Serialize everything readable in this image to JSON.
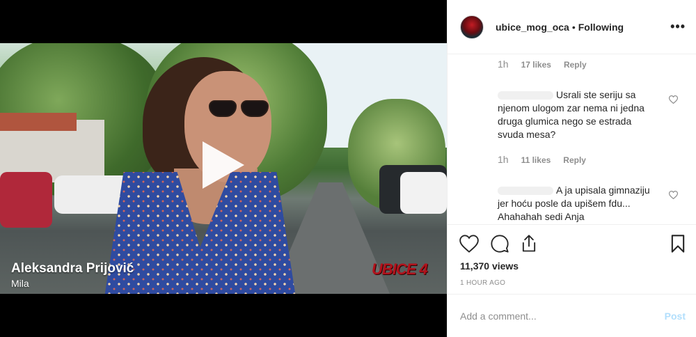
{
  "video": {
    "caption_name": "Aleksandra Prijović",
    "caption_role": "Mila",
    "watermark": "UBICE 4",
    "play_icon": "play-icon"
  },
  "header": {
    "avatar_label": "UBICE MOG OCA",
    "username": "ubice_mog_oca",
    "separator": "•",
    "follow_status": "Following",
    "more_icon": "more-horizontal-icon"
  },
  "comments": [
    {
      "time": "1h",
      "likes": "17 likes",
      "reply": "Reply"
    },
    {
      "text": "Usrali ste seriju sa njenom ulogom zar nema ni jedna druga glumica nego se estrada svuda mesa?",
      "time": "1h",
      "likes": "11 likes",
      "reply": "Reply"
    },
    {
      "text": "A ja upisala gimnaziju jer hoću posle da upišem fdu... Ahahahah sedi Anja"
    }
  ],
  "actions": {
    "icons": [
      "heart-icon",
      "comment-icon",
      "share-icon",
      "bookmark-icon"
    ],
    "views": "11,370 views",
    "time_ago": "1 HOUR AGO"
  },
  "add_comment": {
    "placeholder": "Add a comment...",
    "post_label": "Post"
  },
  "colors": {
    "text": "#262626",
    "muted": "#8e8e8e",
    "post_disabled": "#b2dffc",
    "border": "#efefef"
  }
}
